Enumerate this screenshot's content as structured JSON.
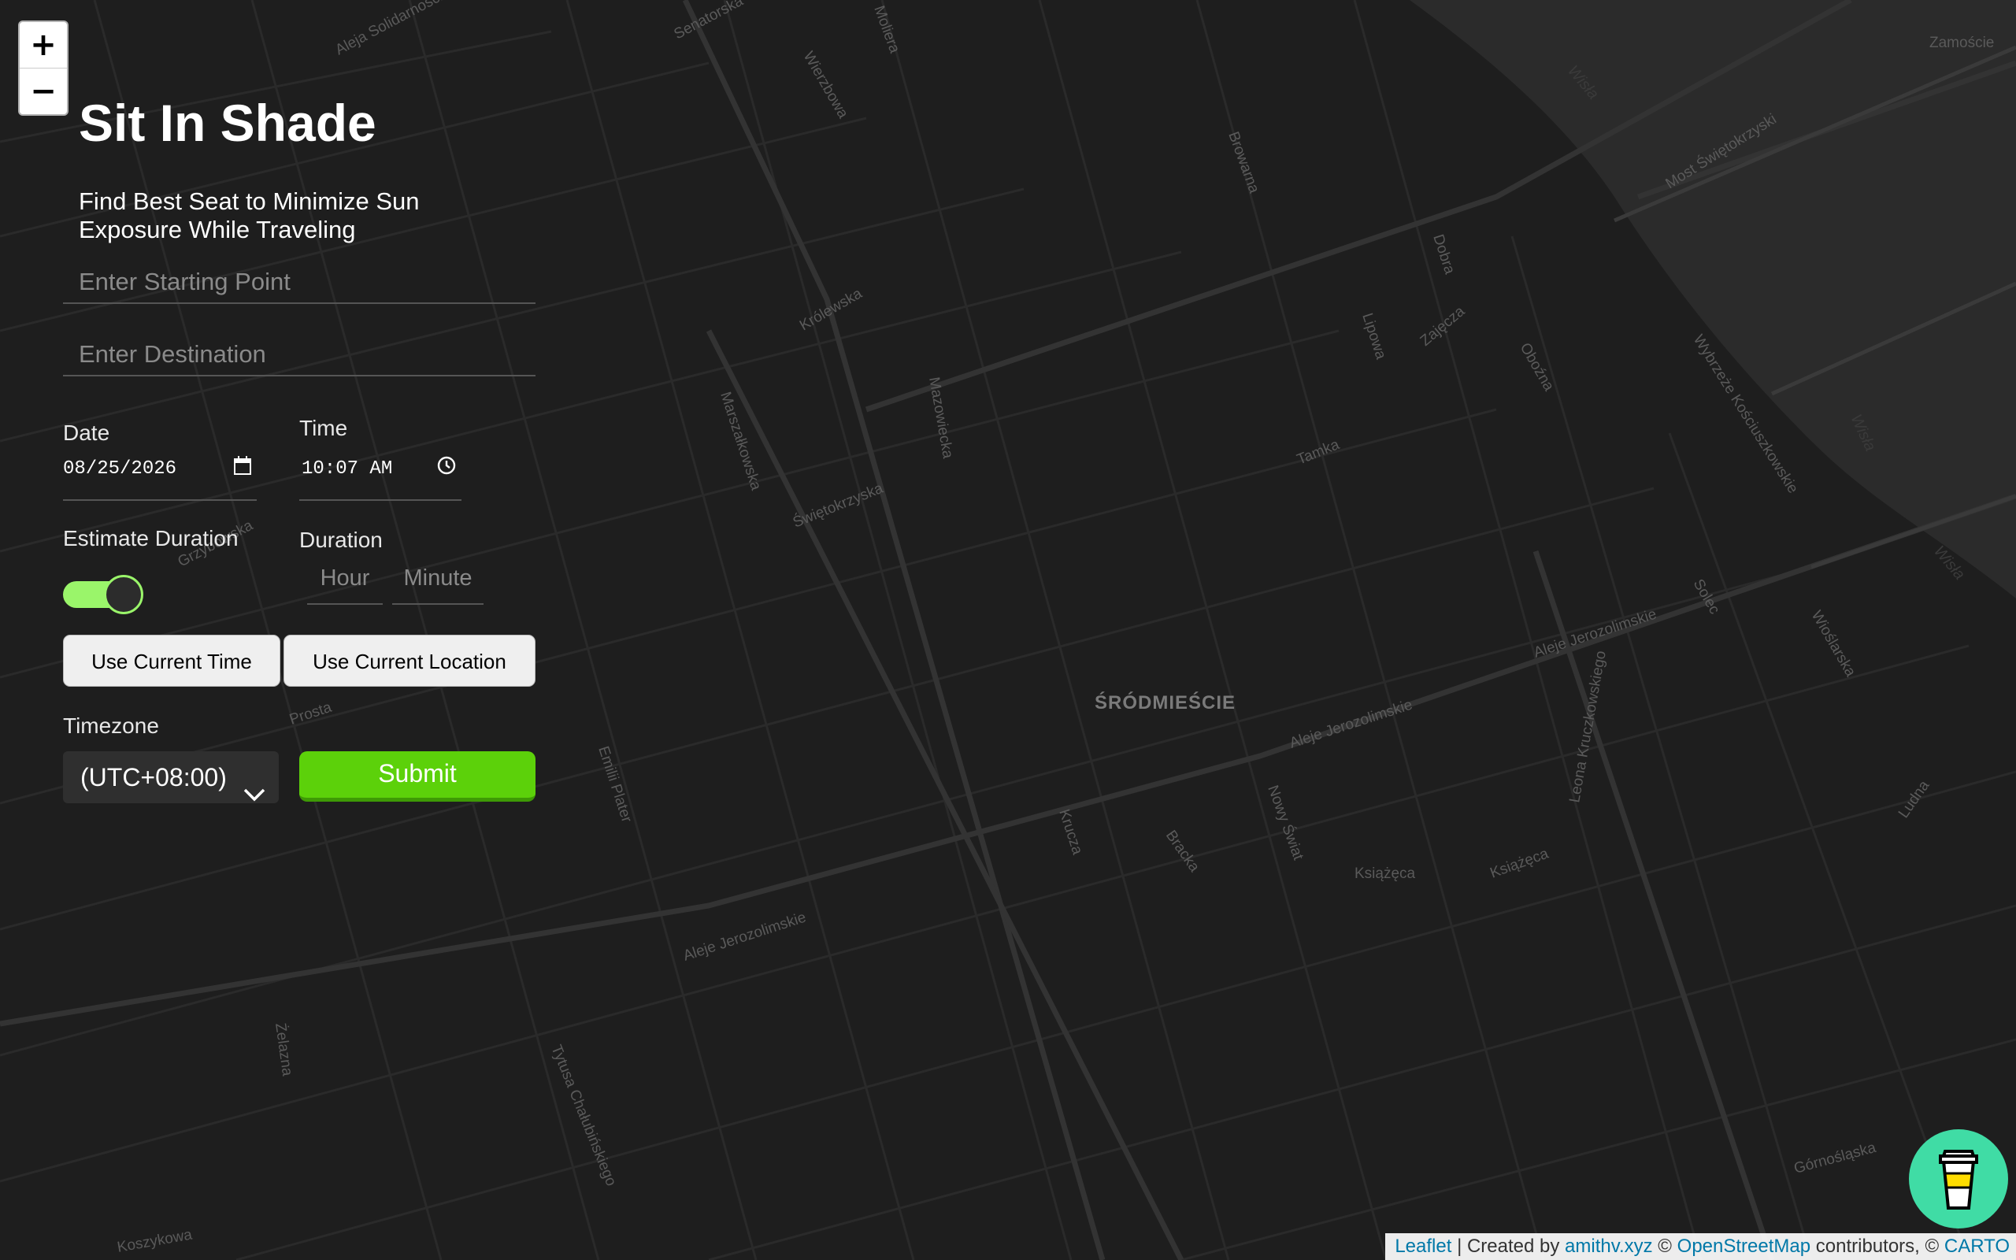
{
  "app": {
    "title": "Sit In Shade",
    "subtitle": "Find Best Seat to Minimize Sun Exposure While Traveling"
  },
  "colors": {
    "accent_green": "#5cd10a",
    "toggle_green": "#9af56a",
    "coffee_button": "#40dca5",
    "map_bg": "#1e1e1e",
    "river": "#2d2d2d",
    "link": "#0078a8"
  },
  "map": {
    "zoom_in": "+",
    "zoom_out": "−",
    "district_label": "ŚRÓDMIEŚCIE",
    "street_labels": [
      "Aleja Solidarności",
      "Senatorska",
      "Wierzbowa",
      "Moliera",
      "Królewska",
      "Marszałkowska",
      "Mazowiecka",
      "Świętokrzyska",
      "Tamka",
      "Aleje Jerozolimskie",
      "Aleje Jerozolimskie",
      "Aleje Jerozolimskie",
      "Emilii Plater",
      "Krucza",
      "Bracka",
      "Nowy Świat",
      "Książęca",
      "Książęca",
      "Prosta",
      "Żelazna",
      "Koszykowa",
      "Tytusa Chałubińskiego",
      "Dobra",
      "Lipowa",
      "Wybrzeże Kościuszkowskie",
      "Most Świętokrzyski",
      "Zamoście",
      "Browarna",
      "Solec",
      "Ludna",
      "Wioślarska",
      "Górnośląska",
      "Leona Kruczkowskiego",
      "Grzybowska",
      "Zajęcza",
      "Oboźna"
    ],
    "river_labels": [
      "Wisła",
      "Wisła",
      "Wisła"
    ]
  },
  "form": {
    "start": {
      "placeholder": "Enter Starting Point",
      "value": ""
    },
    "destination": {
      "placeholder": "Enter Destination",
      "value": ""
    },
    "date": {
      "label": "Date",
      "value": "08/25/2026"
    },
    "time": {
      "label": "Time",
      "value": "10:07 AM"
    },
    "estimate_duration": {
      "label": "Estimate Duration",
      "enabled": true
    },
    "duration": {
      "label": "Duration",
      "hour_placeholder": "Hour",
      "minute_placeholder": "Minute"
    },
    "use_current_time": "Use Current Time",
    "use_current_location": "Use Current Location",
    "timezone": {
      "label": "Timezone",
      "selected": "(UTC+08:00)"
    },
    "submit": "Submit"
  },
  "coffee_button": {
    "icon": "coffee-cup-icon"
  },
  "attribution": {
    "leaflet": "Leaflet",
    "sep1": "| Created by",
    "author": "amithv.xyz",
    "copy1": "©",
    "osm": "OpenStreetMap",
    "contributors": "contributors, ©",
    "carto": "CARTO"
  }
}
